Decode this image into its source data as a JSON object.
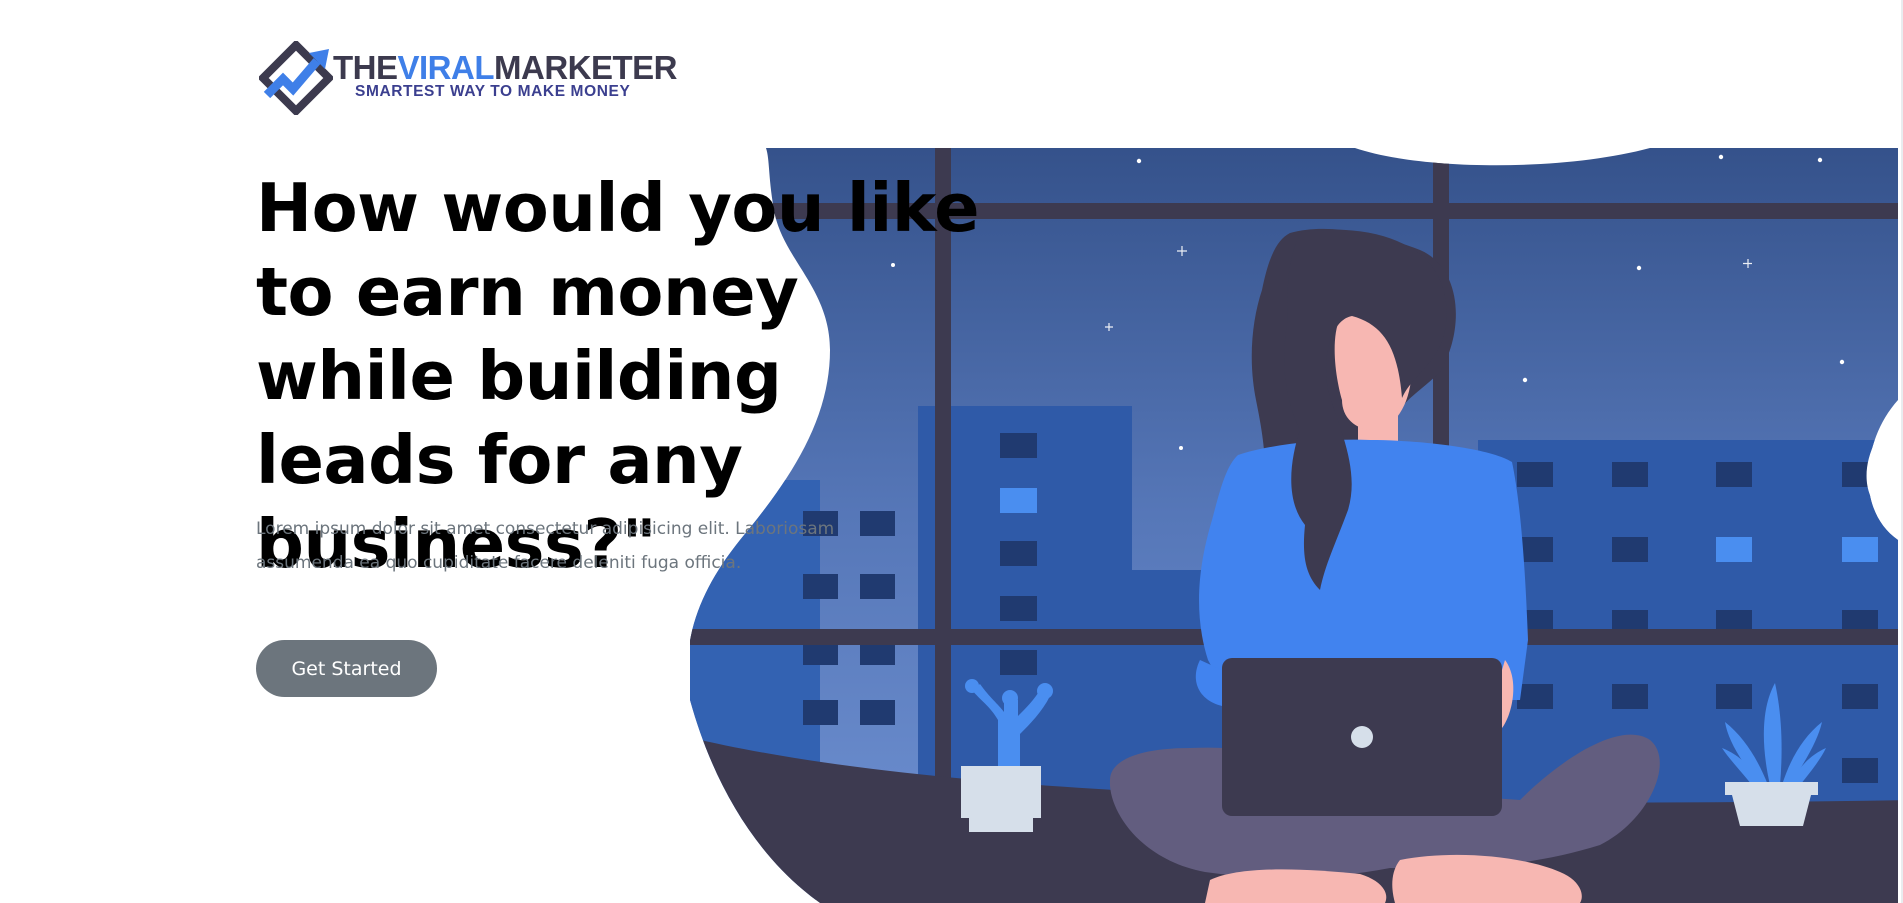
{
  "brand": {
    "word_part1": "THE",
    "word_part2": "VIRAL",
    "word_part3": "MARKETER",
    "tagline": "SMARTEST WAY TO MAKE MONEY",
    "colors": {
      "dark": "#3c3a4e",
      "accent": "#3f7fe8",
      "tagline": "#3b3f8f"
    }
  },
  "hero": {
    "headline": "How would you like to earn money while building leads for any business?\"",
    "subtext": "Lorem ipsum dolor sit amet consectetur adipisicing elit. Laboriosam assumenda ea quo cupiditate facere deleniti fuga officia.",
    "cta_label": "Get Started"
  },
  "illustration": {
    "subject": "woman-working-on-laptop-by-night-window",
    "colors": {
      "sky_top": "#35548c",
      "sky_bottom": "#5b7dc0",
      "building": "#2f5aa8",
      "window_dark": "#203a70",
      "window_lit": "#4a8ef0",
      "frame": "#3d3a50",
      "shirt": "#4183ef",
      "skin": "#f7b7b2",
      "hair": "#3d3a50",
      "pants": "#625d7f",
      "laptop": "#3d3a50",
      "pot": "#d6dfea",
      "plant": "#4a8ef0"
    }
  },
  "buttons": {
    "primary_bg": "#6c757d",
    "primary_text": "#ffffff"
  }
}
